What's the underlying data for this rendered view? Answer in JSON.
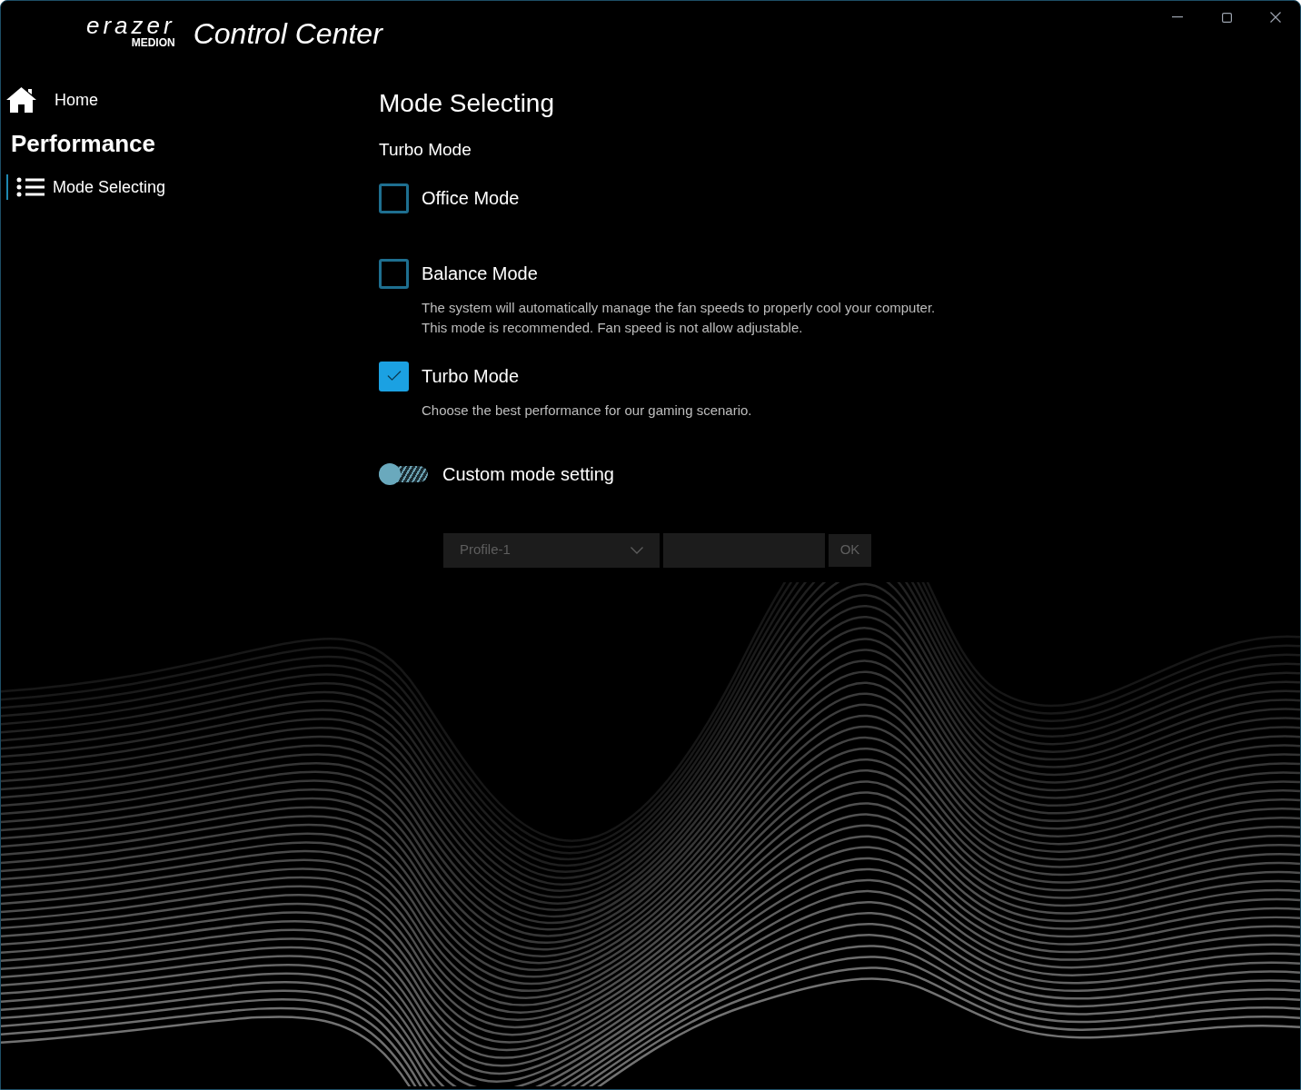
{
  "window": {
    "logo_top": "erazer",
    "logo_bottom": "MEDION",
    "title": "Control Center"
  },
  "sidebar": {
    "home": "Home",
    "section": "Performance",
    "items": [
      {
        "label": "Mode Selecting",
        "selected": true
      }
    ]
  },
  "main": {
    "heading": "Mode Selecting",
    "current_mode": "Turbo Mode",
    "modes": [
      {
        "label": "Office Mode",
        "checked": false
      },
      {
        "label": "Balance Mode",
        "checked": false,
        "description": [
          "The system will automatically manage the fan speeds to properly cool your computer.",
          "This mode is recommended. Fan speed is not allow adjustable."
        ]
      },
      {
        "label": "Turbo Mode",
        "checked": true,
        "description": [
          "Choose the best performance for our gaming scenario."
        ]
      }
    ],
    "custom": {
      "label": "Custom mode setting",
      "on": false,
      "profile": "Profile-1",
      "ok": "OK"
    }
  }
}
